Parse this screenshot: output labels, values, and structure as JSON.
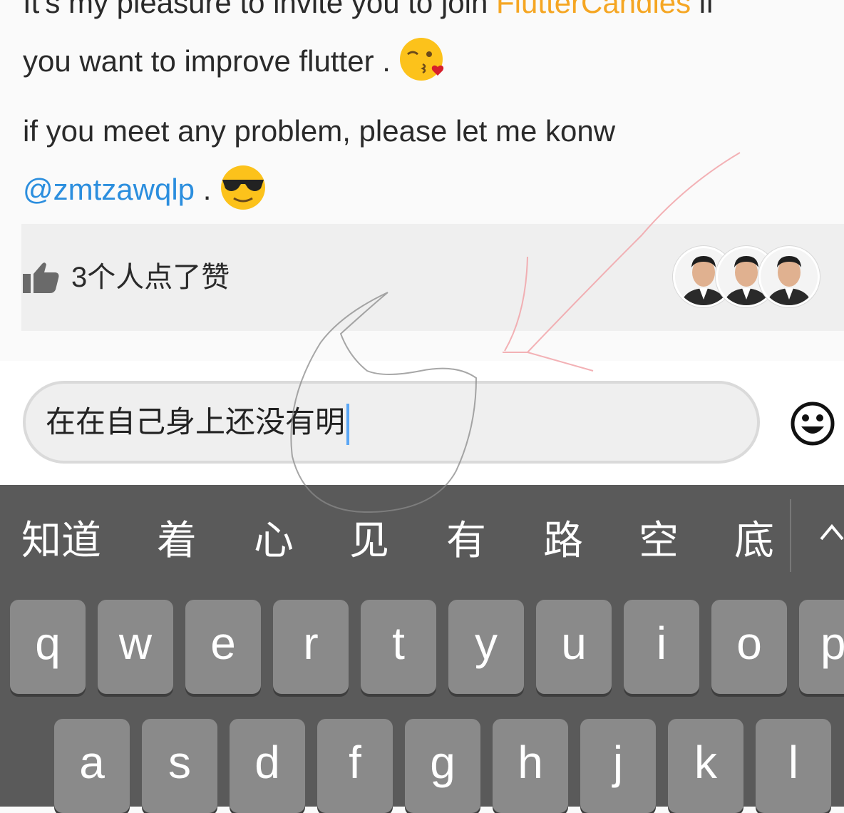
{
  "post": {
    "line1_prefix": "It's my pleasure to invite you to join ",
    "line1_link": "FlutterCandies",
    "line1_suffix": " if",
    "line2": "you want to improve flutter .",
    "line3": "if you meet any problem, please let me konw",
    "mention": "@zmtzawqlp",
    "line4_suffix": " .",
    "emoji_kiss": "kiss-emoji-icon",
    "emoji_cool": "sunglasses-emoji-icon"
  },
  "likes": {
    "text": "3个人点了赞",
    "icon": "thumbs-up-icon",
    "avatar_count": 3
  },
  "input": {
    "value": "在在自己身上还没有明"
  },
  "keyboard": {
    "candidates": [
      "知道",
      "着",
      "心",
      "见",
      "有",
      "路",
      "空",
      "底"
    ],
    "row1": [
      "q",
      "w",
      "e",
      "r",
      "t",
      "y",
      "u",
      "i",
      "o",
      "p"
    ],
    "row2": [
      "a",
      "s",
      "d",
      "f",
      "g",
      "h",
      "j",
      "k",
      "l"
    ]
  },
  "colors": {
    "link_orange": "#f5a623",
    "link_blue": "#2b8ede",
    "keyboard_bg": "#5a5a5a",
    "key_bg": "#8a8a8a"
  }
}
